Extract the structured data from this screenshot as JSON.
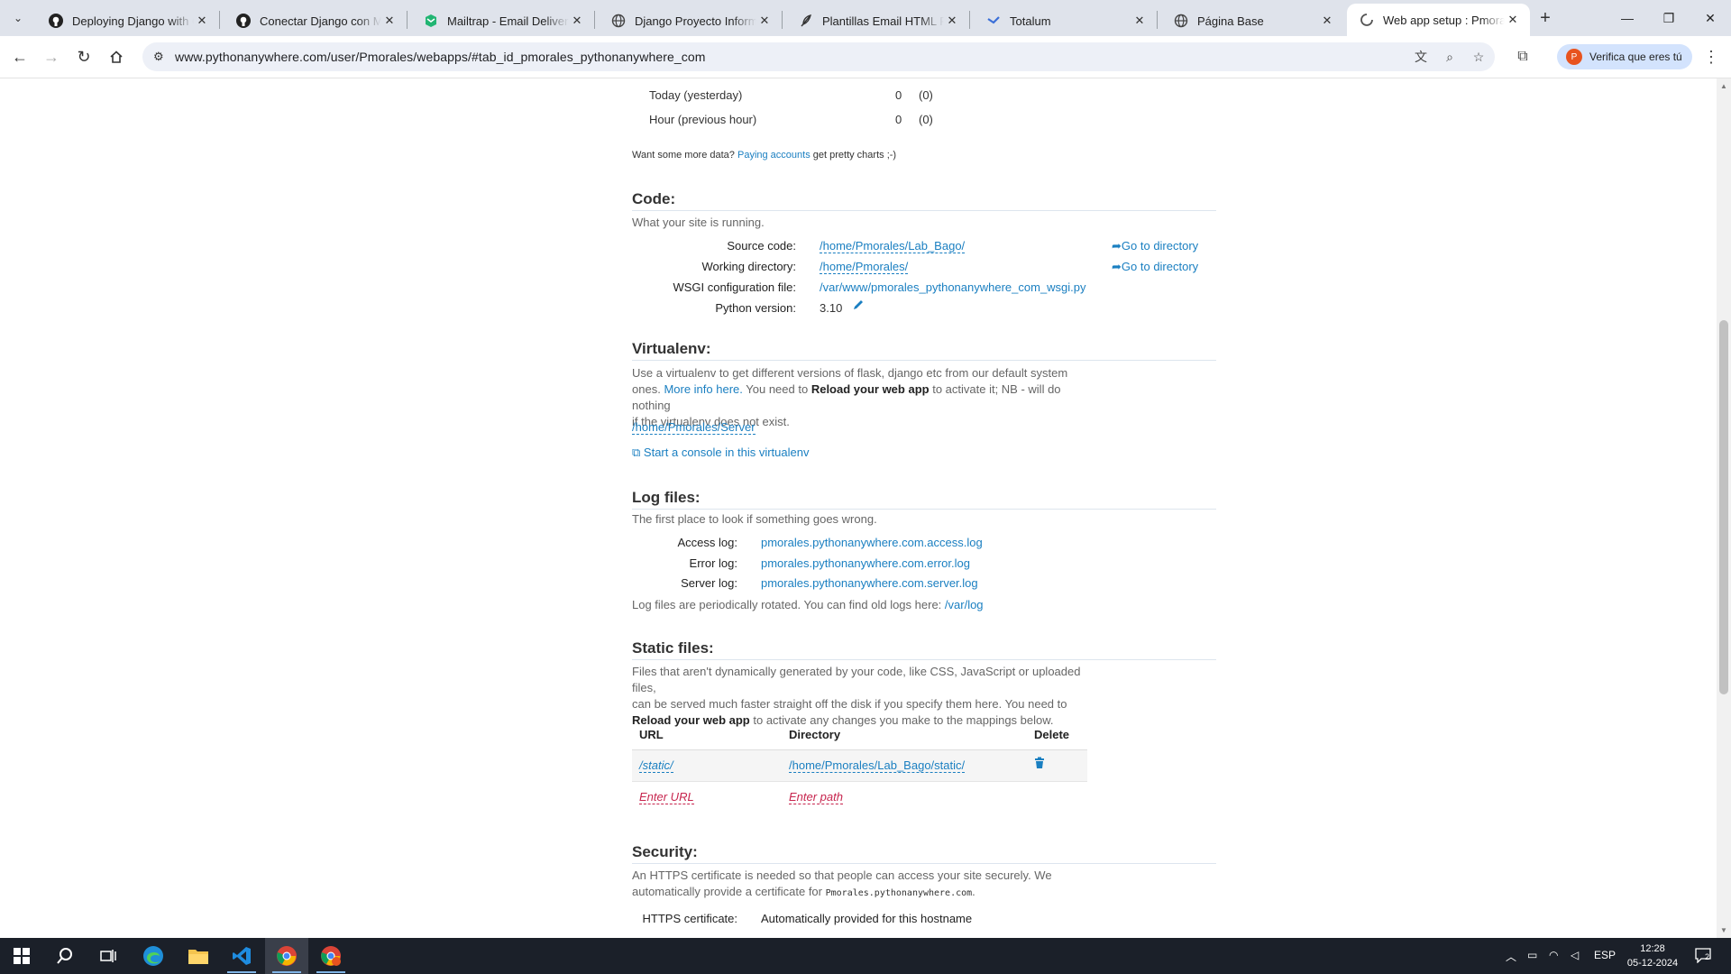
{
  "browser": {
    "tabs": [
      {
        "title": "Deploying Django with Gi",
        "icon": "github-icon"
      },
      {
        "title": "Conectar Django con My",
        "icon": "github-icon"
      },
      {
        "title": "Mailtrap - Email Delivery P",
        "icon": "mailtrap-icon"
      },
      {
        "title": "Django Proyecto Informe",
        "icon": "globe-icon"
      },
      {
        "title": "Plantillas Email HTML Res",
        "icon": "feather-icon"
      },
      {
        "title": "Totalum",
        "icon": "totalum-icon"
      },
      {
        "title": "Página Base",
        "icon": "globe-icon"
      },
      {
        "title": "Web app setup : Pmorale",
        "icon": "loading-icon",
        "active": true
      }
    ],
    "url": "www.pythonanywhere.com/user/Pmorales/webapps/#tab_id_pmorales_pythonanywhere_com",
    "profile_label": "Verifica que eres tú"
  },
  "stats": [
    {
      "label": "Today (yesterday)",
      "value": "0",
      "prev": "(0)"
    },
    {
      "label": "Hour (previous hour)",
      "value": "0",
      "prev": "(0)"
    }
  ],
  "more_data": {
    "prefix": "Want some more data?",
    "link": "Paying accounts",
    "suffix": "get pretty charts ;-)"
  },
  "code": {
    "heading": "Code:",
    "subtitle": "What your site is running.",
    "source_label": "Source code:",
    "source_value": "/home/Pmorales/Lab_Bago/",
    "goto1": "Go to directory",
    "working_label": "Working directory:",
    "working_value": "/home/Pmorales/",
    "goto2": "Go to directory",
    "wsgi_label": "WSGI configuration file:",
    "wsgi_value": "/var/www/pmorales_pythonanywhere_com_wsgi.py",
    "python_label": "Python version:",
    "python_value": "3.10"
  },
  "virtualenv": {
    "heading": "Virtualenv:",
    "text1": "Use a virtualenv to get different versions of flask, django etc from our default system",
    "text2a": "ones.",
    "more_info": "More info here.",
    "text2b": "You need to",
    "reload": "Reload your web app",
    "text2c": "to activate it; NB - will do nothing",
    "text3": "if the virtualenv does not exist.",
    "path": "/home/Pmorales/Server",
    "console": "Start a console in this virtualenv"
  },
  "logs": {
    "heading": "Log files:",
    "subtitle": "The first place to look if something goes wrong.",
    "access_label": "Access log:",
    "access_value": "pmorales.pythonanywhere.com.access.log",
    "error_label": "Error log:",
    "error_value": "pmorales.pythonanywhere.com.error.log",
    "server_label": "Server log:",
    "server_value": "pmorales.pythonanywhere.com.server.log",
    "rotated": "Log files are periodically rotated. You can find old logs here:",
    "rotated_link": "/var/log"
  },
  "static": {
    "heading": "Static files:",
    "text1": "Files that aren't dynamically generated by your code, like CSS, JavaScript or uploaded files,",
    "text2": "can be served much faster straight off the disk if you specify them here. You need to",
    "reload": "Reload your web app",
    "text3": "to activate any changes you make to the mappings below.",
    "col_url": "URL",
    "col_dir": "Directory",
    "col_del": "Delete",
    "row_url": "/static/",
    "row_dir": "/home/Pmorales/Lab_Bago/static/",
    "enter_url": "Enter URL",
    "enter_path": "Enter path"
  },
  "security": {
    "heading": "Security:",
    "text1": "An HTTPS certificate is needed so that people can access your site securely. We",
    "text2": "automatically provide a certificate for",
    "domain": "Pmorales.pythonanywhere.com",
    "cert_label": "HTTPS certificate:",
    "cert_value": "Automatically provided for this hostname"
  },
  "taskbar": {
    "lang": "ESP",
    "time": "12:28",
    "date": "05-12-2024",
    "notif": "2"
  }
}
